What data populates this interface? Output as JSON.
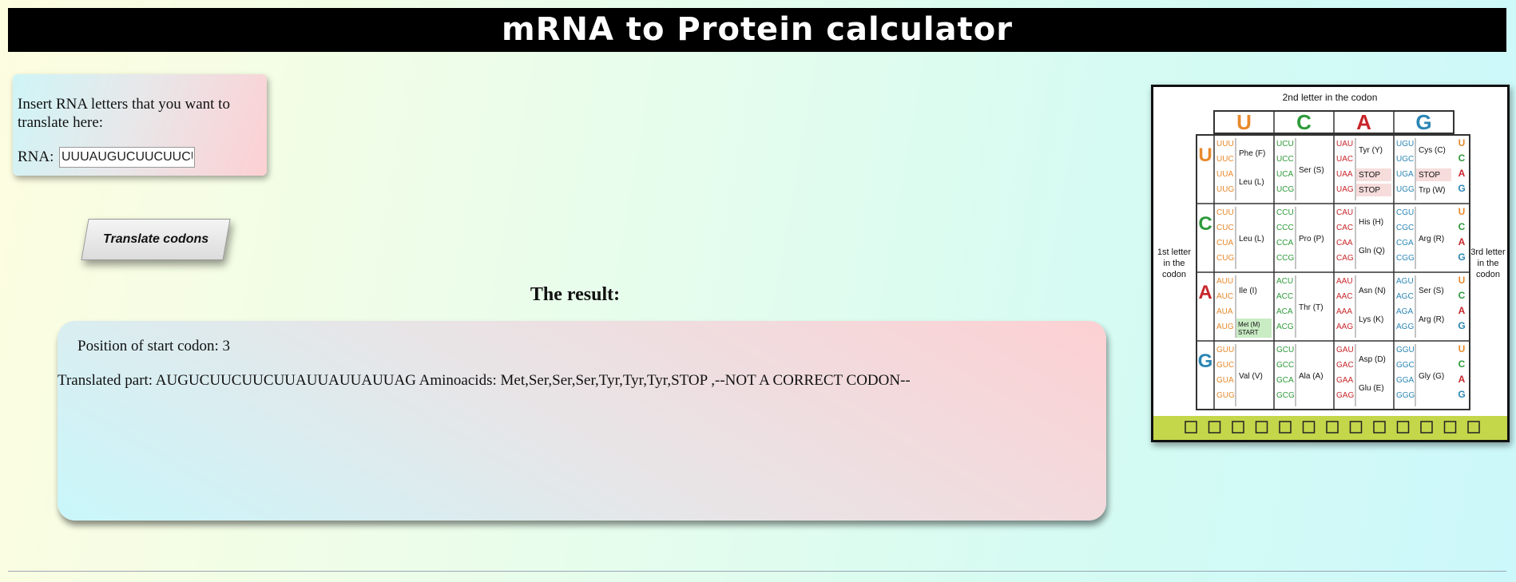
{
  "header": {
    "title": "mRNA to Protein calculator"
  },
  "input_panel": {
    "prompt": "Insert RNA letters that you want to translate here:",
    "rna_label": "RNA:",
    "rna_value": "UUUAUGUCUUCUUCUUA"
  },
  "translate_button": {
    "label": "Translate codons"
  },
  "result": {
    "title": "The result:",
    "start_codon": "Position of start codon: 3",
    "translated": "Translated part: AUGUCUUCUUCUUAUUAUUAUUAG Aminoacids: Met,Ser,Ser,Ser,Tyr,Tyr,Tyr,STOP ,--NOT A CORRECT CODON--"
  },
  "codon_table": {
    "title": "2nd letter in the codon",
    "left_label": [
      "1st letter",
      "in the",
      "codon"
    ],
    "right_label": [
      "3rd letter",
      "in the",
      "codon"
    ],
    "bases": [
      "U",
      "C",
      "A",
      "G"
    ],
    "base_colors": {
      "U": "#e8892c",
      "C": "#2d9a3a",
      "A": "#c8262b",
      "G": "#2b86b5"
    },
    "cells": [
      [
        {
          "codons": [
            "UUU",
            "UUC",
            "UUA",
            "UUG"
          ],
          "aa": [
            "Phe (F)",
            "Leu (L)"
          ]
        },
        {
          "codons": [
            "UCU",
            "UCC",
            "UCA",
            "UCG"
          ],
          "aa": [
            "Ser (S)"
          ]
        },
        {
          "codons": [
            "UAU",
            "UAC",
            "UAA",
            "UAG"
          ],
          "aa": [
            "Tyr (Y)",
            "STOP",
            "STOP"
          ]
        },
        {
          "codons": [
            "UGU",
            "UGC",
            "UGA",
            "UGG"
          ],
          "aa": [
            "Cys (C)",
            "STOP",
            "Trp (W)"
          ]
        }
      ],
      [
        {
          "codons": [
            "CUU",
            "CUC",
            "CUA",
            "CUG"
          ],
          "aa": [
            "Leu (L)"
          ]
        },
        {
          "codons": [
            "CCU",
            "CCC",
            "CCA",
            "CCG"
          ],
          "aa": [
            "Pro (P)"
          ]
        },
        {
          "codons": [
            "CAU",
            "CAC",
            "CAA",
            "CAG"
          ],
          "aa": [
            "His (H)",
            "Gln (Q)"
          ]
        },
        {
          "codons": [
            "CGU",
            "CGC",
            "CGA",
            "CGG"
          ],
          "aa": [
            "Arg (R)"
          ]
        }
      ],
      [
        {
          "codons": [
            "AUU",
            "AUC",
            "AUA",
            "AUG"
          ],
          "aa": [
            "Ile (I)",
            "Met (M) START"
          ]
        },
        {
          "codons": [
            "ACU",
            "ACC",
            "ACA",
            "ACG"
          ],
          "aa": [
            "Thr (T)"
          ]
        },
        {
          "codons": [
            "AAU",
            "AAC",
            "AAA",
            "AAG"
          ],
          "aa": [
            "Asn (N)",
            "Lys (K)"
          ]
        },
        {
          "codons": [
            "AGU",
            "AGC",
            "AGA",
            "AGG"
          ],
          "aa": [
            "Ser (S)",
            "Arg (R)"
          ]
        }
      ],
      [
        {
          "codons": [
            "GUU",
            "GUC",
            "GUA",
            "GUG"
          ],
          "aa": [
            "Val (V)"
          ]
        },
        {
          "codons": [
            "GCU",
            "GCC",
            "GCA",
            "GCG"
          ],
          "aa": [
            "Ala (A)"
          ]
        },
        {
          "codons": [
            "GAU",
            "GAC",
            "GAA",
            "GAG"
          ],
          "aa": [
            "Asp (D)",
            "Glu (E)"
          ]
        },
        {
          "codons": [
            "GGU",
            "GGC",
            "GGA",
            "GGG"
          ],
          "aa": [
            "Gly (G)"
          ]
        }
      ]
    ]
  }
}
